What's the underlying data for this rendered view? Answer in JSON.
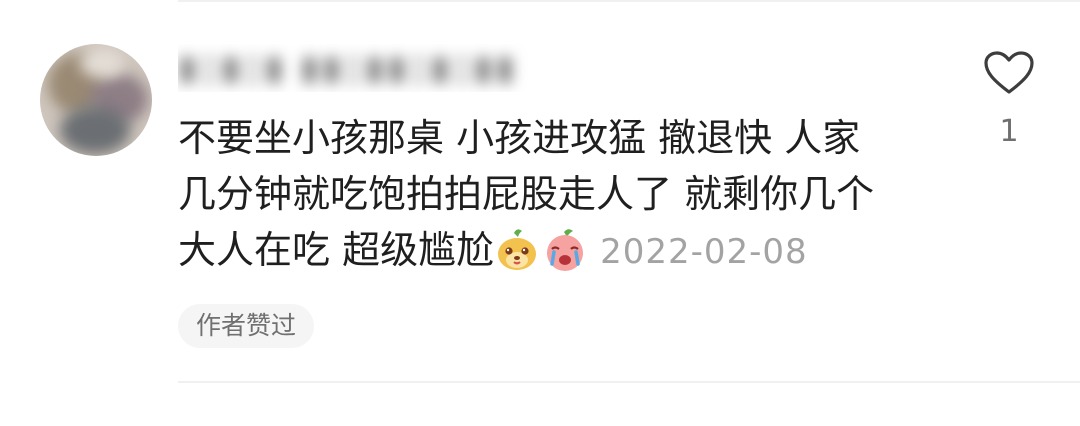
{
  "comment": {
    "text_lines": [
      "不要坐小孩那桌 小孩进攻猛 撤退快  人家",
      "几分钟就吃饱拍拍屁股走人了 就剩你几个",
      "大人在吃 超级尴尬"
    ],
    "emojis": [
      "dog-face-emoji",
      "crying-peach-emoji"
    ],
    "date": "2022-02-08",
    "author_liked_label": "作者赞过",
    "like_count": "1"
  },
  "icons": {
    "like": "heart-outline-icon"
  },
  "colors": {
    "text": "#1f1f1f",
    "muted": "#a3a3a3",
    "tag_bg": "#f5f5f5",
    "divider": "#f0f0f0"
  }
}
